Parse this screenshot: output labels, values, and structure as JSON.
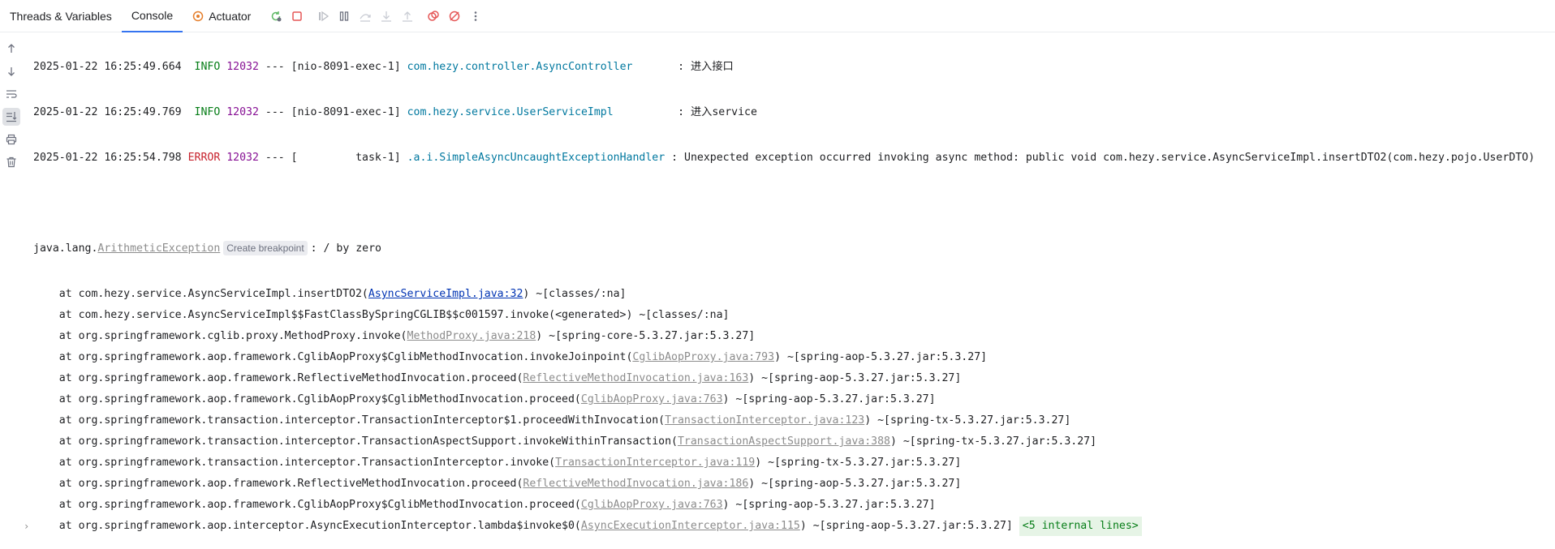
{
  "tabs": {
    "threads": "Threads & Variables",
    "console": "Console",
    "actuator": "Actuator"
  },
  "colors": {
    "accent": "#3574f0",
    "info": "#067d17",
    "pid": "#871094",
    "error": "#c7222d",
    "logger": "#00789f",
    "link": "#0033b3",
    "stop": "#e55757",
    "rerun": "#5fb865",
    "actuator": "#e57e2b"
  },
  "toolbar_icons": [
    "rerun-icon",
    "stop-icon",
    "resume-icon",
    "pause-icon",
    "step-over-icon",
    "step-into-icon",
    "step-out-icon",
    "view-breakpoints-icon",
    "mute-breakpoints-icon",
    "more-icon"
  ],
  "left_icons": [
    "scroll-up-icon",
    "scroll-down-icon",
    "soft-wrap-icon",
    "scroll-to-end-icon",
    "print-icon",
    "clear-icon"
  ],
  "log": [
    {
      "ts": "2025-01-22 16:25:49.664",
      "level": " INFO",
      "pid": "12032",
      "sep": "---",
      "thread": "[nio-8091-exec-1]",
      "logger": "com.hezy.controller.AsyncController      ",
      "msg": ": 进入接口"
    },
    {
      "ts": "2025-01-22 16:25:49.769",
      "level": " INFO",
      "pid": "12032",
      "sep": "---",
      "thread": "[nio-8091-exec-1]",
      "logger": "com.hezy.service.UserServiceImpl         ",
      "msg": ": 进入service"
    },
    {
      "ts": "2025-01-22 16:25:54.798",
      "level": "ERROR",
      "pid": "12032",
      "sep": "---",
      "thread": "[         task-1]",
      "logger": ".a.i.SimpleAsyncUncaughtExceptionHandler",
      "msg": ": Unexpected exception occurred invoking async method: public void com.hezy.service.AsyncServiceImpl.insertDTO2(com.hezy.pojo.UserDTO)"
    }
  ],
  "exception": {
    "prefix": "java.lang.",
    "name": "ArithmeticException",
    "chip": "Create breakpoint",
    "message": ": / by zero"
  },
  "stack": [
    {
      "pre": "    at com.hezy.service.AsyncServiceImpl.insertDTO2(",
      "link": "AsyncServiceImpl.java:32",
      "primary": true,
      "post": ") ~[classes/:na]"
    },
    {
      "pre": "    at com.hezy.service.AsyncServiceImpl$$FastClassBySpringCGLIB$$c001597.invoke(<generated>) ~[classes/:na]",
      "link": "",
      "primary": false,
      "post": ""
    },
    {
      "pre": "    at org.springframework.cglib.proxy.MethodProxy.invoke(",
      "link": "MethodProxy.java:218",
      "primary": false,
      "post": ") ~[spring-core-5.3.27.jar:5.3.27]"
    },
    {
      "pre": "    at org.springframework.aop.framework.CglibAopProxy$CglibMethodInvocation.invokeJoinpoint(",
      "link": "CglibAopProxy.java:793",
      "primary": false,
      "post": ") ~[spring-aop-5.3.27.jar:5.3.27]"
    },
    {
      "pre": "    at org.springframework.aop.framework.ReflectiveMethodInvocation.proceed(",
      "link": "ReflectiveMethodInvocation.java:163",
      "primary": false,
      "post": ") ~[spring-aop-5.3.27.jar:5.3.27]"
    },
    {
      "pre": "    at org.springframework.aop.framework.CglibAopProxy$CglibMethodInvocation.proceed(",
      "link": "CglibAopProxy.java:763",
      "primary": false,
      "post": ") ~[spring-aop-5.3.27.jar:5.3.27]"
    },
    {
      "pre": "    at org.springframework.transaction.interceptor.TransactionInterceptor$1.proceedWithInvocation(",
      "link": "TransactionInterceptor.java:123",
      "primary": false,
      "post": ") ~[spring-tx-5.3.27.jar:5.3.27]"
    },
    {
      "pre": "    at org.springframework.transaction.interceptor.TransactionAspectSupport.invokeWithinTransaction(",
      "link": "TransactionAspectSupport.java:388",
      "primary": false,
      "post": ") ~[spring-tx-5.3.27.jar:5.3.27]"
    },
    {
      "pre": "    at org.springframework.transaction.interceptor.TransactionInterceptor.invoke(",
      "link": "TransactionInterceptor.java:119",
      "primary": false,
      "post": ") ~[spring-tx-5.3.27.jar:5.3.27]"
    },
    {
      "pre": "    at org.springframework.aop.framework.ReflectiveMethodInvocation.proceed(",
      "link": "ReflectiveMethodInvocation.java:186",
      "primary": false,
      "post": ") ~[spring-aop-5.3.27.jar:5.3.27]"
    },
    {
      "pre": "    at org.springframework.aop.framework.CglibAopProxy$CglibMethodInvocation.proceed(",
      "link": "CglibAopProxy.java:763",
      "primary": false,
      "post": ") ~[spring-aop-5.3.27.jar:5.3.27]"
    },
    {
      "pre": "    at org.springframework.aop.interceptor.AsyncExecutionInterceptor.lambda$invoke$0(",
      "link": "AsyncExecutionInterceptor.java:115",
      "primary": false,
      "post": ") ~[spring-aop-5.3.27.jar:5.3.27]",
      "fold": "<5 internal lines>"
    }
  ]
}
